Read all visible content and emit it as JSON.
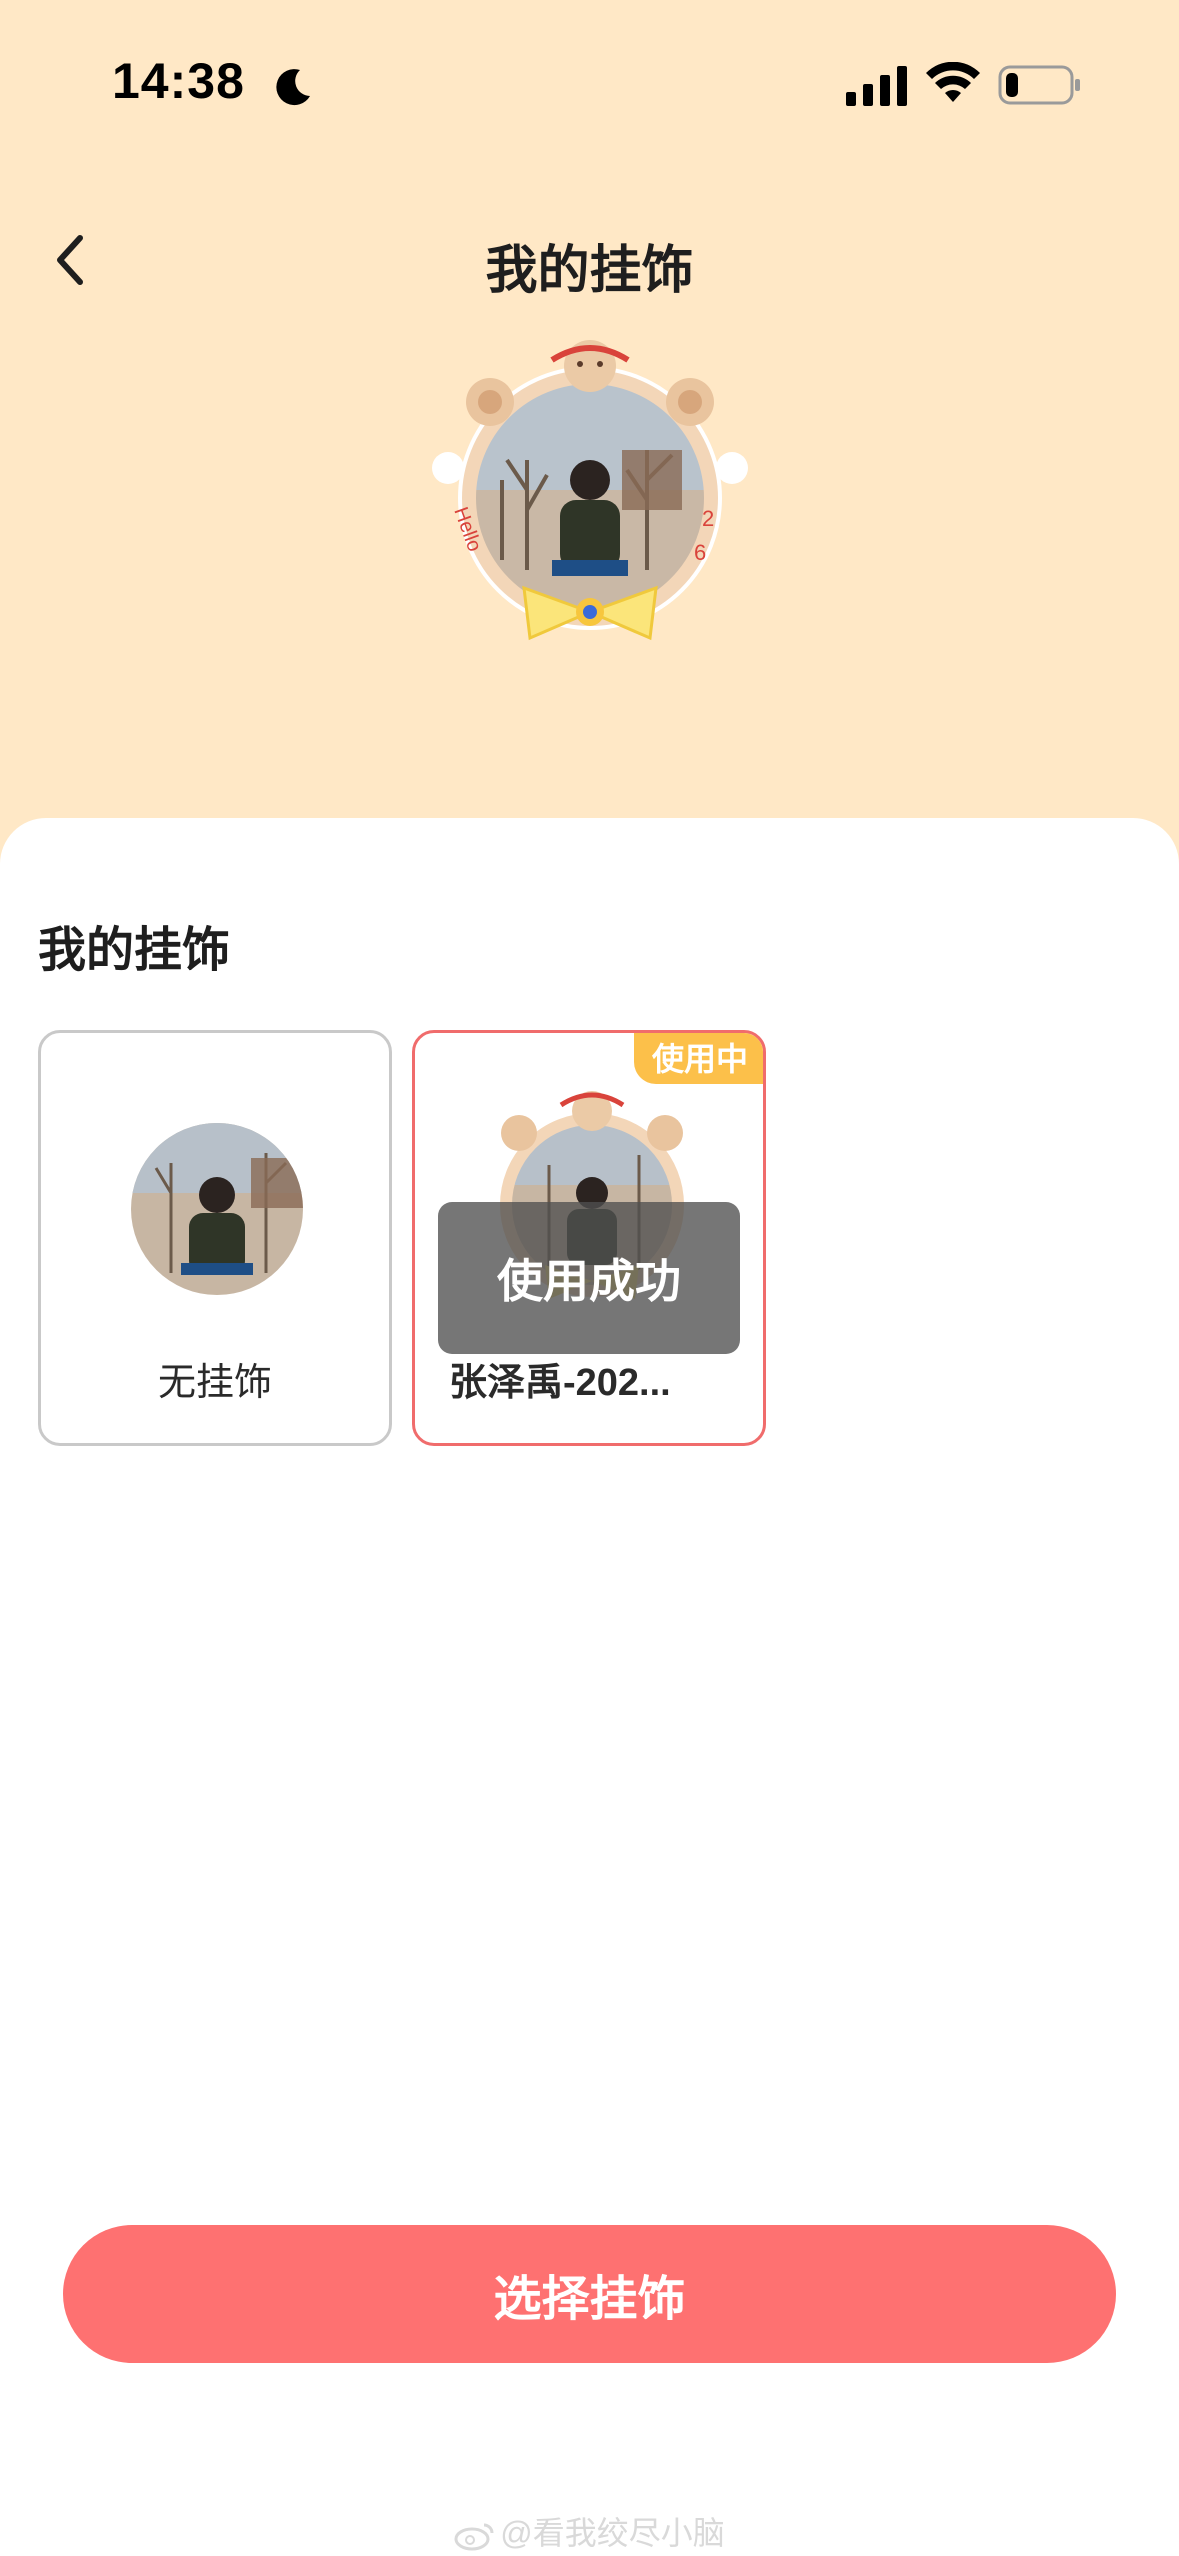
{
  "status_bar": {
    "time": "14:38",
    "icons": [
      "moon-icon",
      "cellular-signal-icon",
      "wifi-icon",
      "battery-icon"
    ],
    "battery_level": 0.2
  },
  "header": {
    "back_icon": "chevron-left-icon",
    "title": "我的挂饰"
  },
  "section": {
    "title": "我的挂饰"
  },
  "cards": [
    {
      "label": "无挂饰",
      "selected": false
    },
    {
      "label": "张泽禹-202...",
      "badge": "使用中",
      "selected": true
    }
  ],
  "toast": {
    "text": "使用成功"
  },
  "primary_button": {
    "label": "选择挂饰"
  },
  "watermark": {
    "text": "@看我绞尽小脑"
  },
  "colors": {
    "header_bg": "#ffe8c6",
    "accent": "#fe7171",
    "badge": "#fcc04a",
    "selected_border": "#f06c6c"
  }
}
